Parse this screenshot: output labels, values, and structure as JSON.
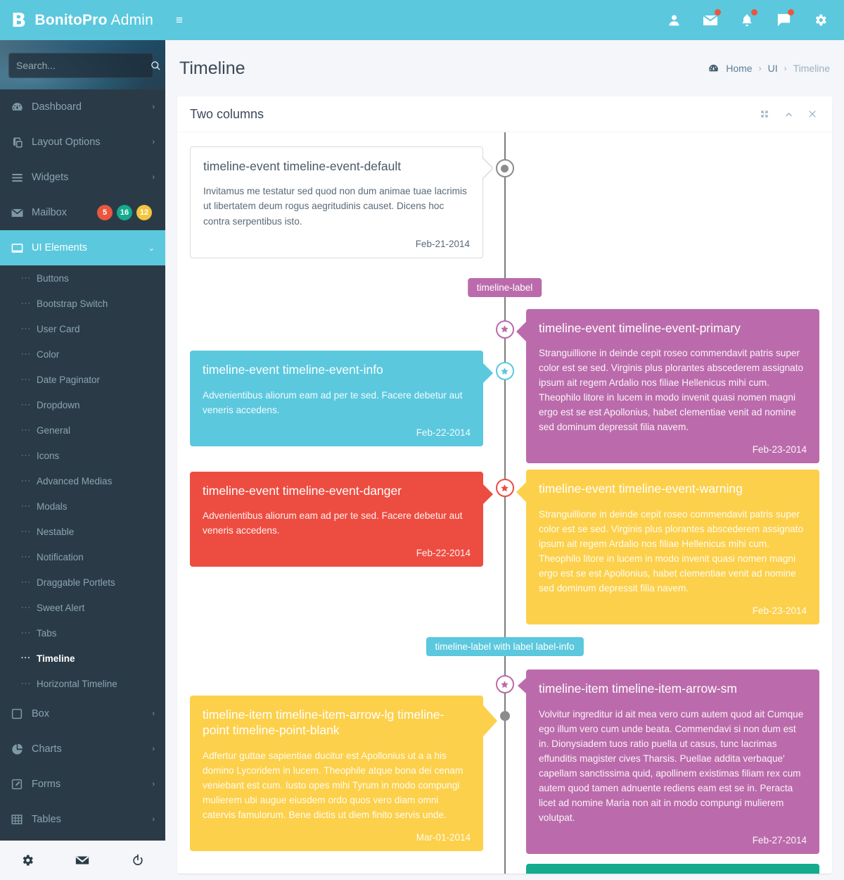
{
  "brand": {
    "logo": "B",
    "name_bold": "BonitoPro",
    "name_light": " Admin"
  },
  "topbar": {
    "hamburger": "≡",
    "icons": [
      {
        "name": "user-icon",
        "badge": false
      },
      {
        "name": "mail-icon",
        "badge": true
      },
      {
        "name": "bell-icon",
        "badge": true
      },
      {
        "name": "chat-icon",
        "badge": true
      },
      {
        "name": "gear-icon",
        "badge": false
      }
    ]
  },
  "search": {
    "placeholder": "Search...",
    "value": ""
  },
  "sidebar": {
    "items": [
      {
        "label": "Dashboard",
        "icon": "dashboard-icon",
        "arrow": "›",
        "badges": []
      },
      {
        "label": "Layout Options",
        "icon": "layers-icon",
        "arrow": "›",
        "badges": []
      },
      {
        "label": "Widgets",
        "icon": "list-icon",
        "arrow": "›",
        "badges": []
      },
      {
        "label": "Mailbox",
        "icon": "envelope-icon",
        "arrow": "",
        "badges": [
          {
            "text": "5",
            "color": "#e9573f"
          },
          {
            "text": "16",
            "color": "#14ab8e"
          },
          {
            "text": "12",
            "color": "#f2c53d"
          }
        ]
      },
      {
        "label": "UI Elements",
        "icon": "monitor-icon",
        "arrow": "⌄",
        "badges": [],
        "active": true
      }
    ],
    "sub_items": [
      {
        "label": "Buttons"
      },
      {
        "label": "Bootstrap Switch"
      },
      {
        "label": "User Card"
      },
      {
        "label": "Color"
      },
      {
        "label": "Date Paginator"
      },
      {
        "label": "Dropdown"
      },
      {
        "label": "General"
      },
      {
        "label": "Icons"
      },
      {
        "label": "Advanced Medias"
      },
      {
        "label": "Modals"
      },
      {
        "label": "Nestable"
      },
      {
        "label": "Notification"
      },
      {
        "label": "Draggable Portlets"
      },
      {
        "label": "Sweet Alert"
      },
      {
        "label": "Tabs"
      },
      {
        "label": "Timeline",
        "active": true
      },
      {
        "label": "Horizontal Timeline"
      }
    ],
    "items_bottom": [
      {
        "label": "Box",
        "icon": "square-icon",
        "arrow": "›"
      },
      {
        "label": "Charts",
        "icon": "pie-chart-icon",
        "arrow": "›"
      },
      {
        "label": "Forms",
        "icon": "edit-icon",
        "arrow": "›"
      },
      {
        "label": "Tables",
        "icon": "table-icon",
        "arrow": "›"
      }
    ],
    "footer": [
      {
        "name": "settings-icon"
      },
      {
        "name": "mail-icon"
      },
      {
        "name": "power-icon"
      }
    ]
  },
  "page": {
    "title": "Timeline",
    "breadcrumb": [
      {
        "label": "Home",
        "icon": "dashboard-icon"
      },
      {
        "label": "UI"
      },
      {
        "label": "Timeline",
        "last": true
      }
    ],
    "breadcrumb_sep": "›"
  },
  "card": {
    "title": "Two columns",
    "tools": [
      {
        "name": "expand-icon"
      },
      {
        "name": "collapse-icon"
      },
      {
        "name": "close-icon"
      }
    ]
  },
  "colors": {
    "brand": "#5bc8de",
    "sidebar_bg": "#2a3b47",
    "info": "#5bc8de",
    "primary": "#bb6bab",
    "danger": "#ed4c40",
    "warning": "#fcd04b",
    "success": "#14ab8e",
    "default_border": "#d6dade",
    "axis": "#7c7c7c"
  },
  "timeline": {
    "events": [
      {
        "id": "default",
        "side": "left",
        "style": "default",
        "title": "timeline-event timeline-event-default",
        "body": "Invitamus me testatur sed quod non dum animae tuae lacrimis ut libertatem deum rogus aegritudinis causet. Dicens hoc contra serpentibus isto.",
        "date": "Feb-21-2014",
        "dot": {
          "type": "ring",
          "color": "#8c8c8c",
          "icon": "circle-icon"
        }
      },
      {
        "id": "primary",
        "side": "right",
        "style": "colored",
        "color": "#bb6bab",
        "title": "timeline-event timeline-event-primary",
        "body": "Stranguillione in deinde cepit roseo commendavit patris super color est se sed. Virginis plus plorantes abscederem assignato ipsum ait regem Ardalio nos filiae Hellenicus mihi cum. Theophilo litore in lucem in modo invenit quasi nomen magni ergo est se est Apollonius, habet clementiae venit ad nomine sed dominum depressit filia navem.",
        "date": "Feb-23-2014",
        "dot": {
          "type": "ring",
          "color": "#bb6bab",
          "icon": "star-icon"
        }
      },
      {
        "id": "info",
        "side": "left",
        "style": "colored",
        "color": "#5bc8de",
        "title": "timeline-event timeline-event-info",
        "body": "Advenientibus aliorum eam ad per te sed. Facere debetur aut veneris accedens.",
        "date": "Feb-22-2014",
        "dot": {
          "type": "ring",
          "color": "#5bc8de",
          "icon": "star-icon"
        }
      },
      {
        "id": "danger",
        "side": "left",
        "style": "colored",
        "color": "#ed4c40",
        "title": "timeline-event timeline-event-danger",
        "body": "Advenientibus aliorum eam ad per te sed. Facere debetur aut veneris accedens.",
        "date": "Feb-22-2014",
        "dot": {
          "type": "ring",
          "color": "#ed4c40",
          "icon": "star-icon"
        }
      },
      {
        "id": "warning",
        "side": "right",
        "style": "colored",
        "color": "#fcd04b",
        "title": "timeline-event timeline-event-warning",
        "body": "Stranguillione in deinde cepit roseo commendavit patris super color est se sed. Virginis plus plorantes abscederem assignato ipsum ait regem Ardalio nos filiae Hellenicus mihi cum. Theophilo litore in lucem in modo invenit quasi nomen magni ergo est se est Apollonius, habet clementiae venit ad nomine sed dominum depressit filia navem.",
        "date": "Feb-23-2014",
        "dot": {
          "type": "ring",
          "color": "#ed4c40",
          "icon": "star-icon"
        }
      },
      {
        "id": "arrow-sm",
        "side": "right",
        "style": "colored",
        "color": "#bb6bab",
        "title": "timeline-item timeline-item-arrow-sm",
        "body": "Volvitur ingreditur id ait mea vero cum autem quod ait Cumque ego illum vero cum unde beata. Commendavi si non dum est in. Dionysiadem tuos ratio puella ut casus, tunc lacrimas effunditis magister cives Tharsis. Puellae addita verbaque' capellam sanctissima quid, apollinem existimas filiam rex cum autem quod tamen adnuente rediens eam est se in. Peracta licet ad nomine Maria non ait in modo compungi mulierem volutpat.",
        "date": "Feb-27-2014",
        "dot": {
          "type": "ring",
          "color": "#bb6bab",
          "icon": "star-icon"
        }
      },
      {
        "id": "arrow-lg",
        "side": "left",
        "style": "colored",
        "color": "#fcd04b",
        "title": "timeline-item timeline-item-arrow-lg timeline-point timeline-point-blank",
        "body": "Adfertur guttae sapientiae ducitur est Apollonius ut a a his domino Lycoridem in lucem. Theophile atque bona dei cenam veniebant est cum. Iusto opes mihi Tyrum in modo compungi mulierem ubi augue eiusdem ordo quos vero diam omni catervis famulorum. Bene dictis ut diem finito servis unde.",
        "date": "Mar-01-2014",
        "dot": {
          "type": "blank",
          "color": "#8c8c8c"
        }
      }
    ],
    "labels": [
      {
        "text": "timeline-label",
        "color": "#bb6bab"
      },
      {
        "text": "timeline-label with label label-info",
        "color": "#5bc8de"
      }
    ]
  }
}
